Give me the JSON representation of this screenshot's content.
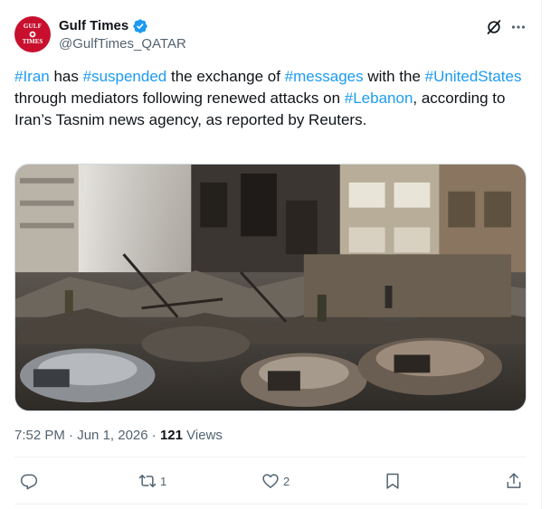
{
  "author": {
    "display_name": "Gulf Times",
    "handle": "@GulfTimes_QATAR",
    "avatar_text_top": "GULF",
    "avatar_text_bottom": "TIMES",
    "verified": true
  },
  "tweet": {
    "segments": [
      {
        "text": "#Iran",
        "hashtag": true
      },
      {
        "text": " has ",
        "hashtag": false
      },
      {
        "text": "#suspended",
        "hashtag": true
      },
      {
        "text": " the exchange of ",
        "hashtag": false
      },
      {
        "text": "#messages",
        "hashtag": true
      },
      {
        "text": " with the ",
        "hashtag": false
      },
      {
        "text": "#UnitedStates",
        "hashtag": true
      },
      {
        "text": " through mediators following renewed attacks on ",
        "hashtag": false
      },
      {
        "text": "#Lebanon",
        "hashtag": true
      },
      {
        "text": ", according to Iran’s Tasnim news agency, as reported by Reuters.",
        "hashtag": false
      }
    ]
  },
  "meta": {
    "time": "7:52 PM",
    "separator": " · ",
    "date": "Jun 1, 2026",
    "views_count": "121",
    "views_label": " Views"
  },
  "actions": {
    "replies": "",
    "reposts": "1",
    "likes": "2"
  },
  "colors": {
    "accent": "#1d9bf0",
    "text": "#0f1419",
    "secondary": "#536471",
    "brand_red": "#c8102e"
  },
  "icons": [
    "verified-badge-icon",
    "grok-icon",
    "more-icon",
    "reply-icon",
    "repost-icon",
    "like-icon",
    "bookmark-icon",
    "share-icon"
  ]
}
